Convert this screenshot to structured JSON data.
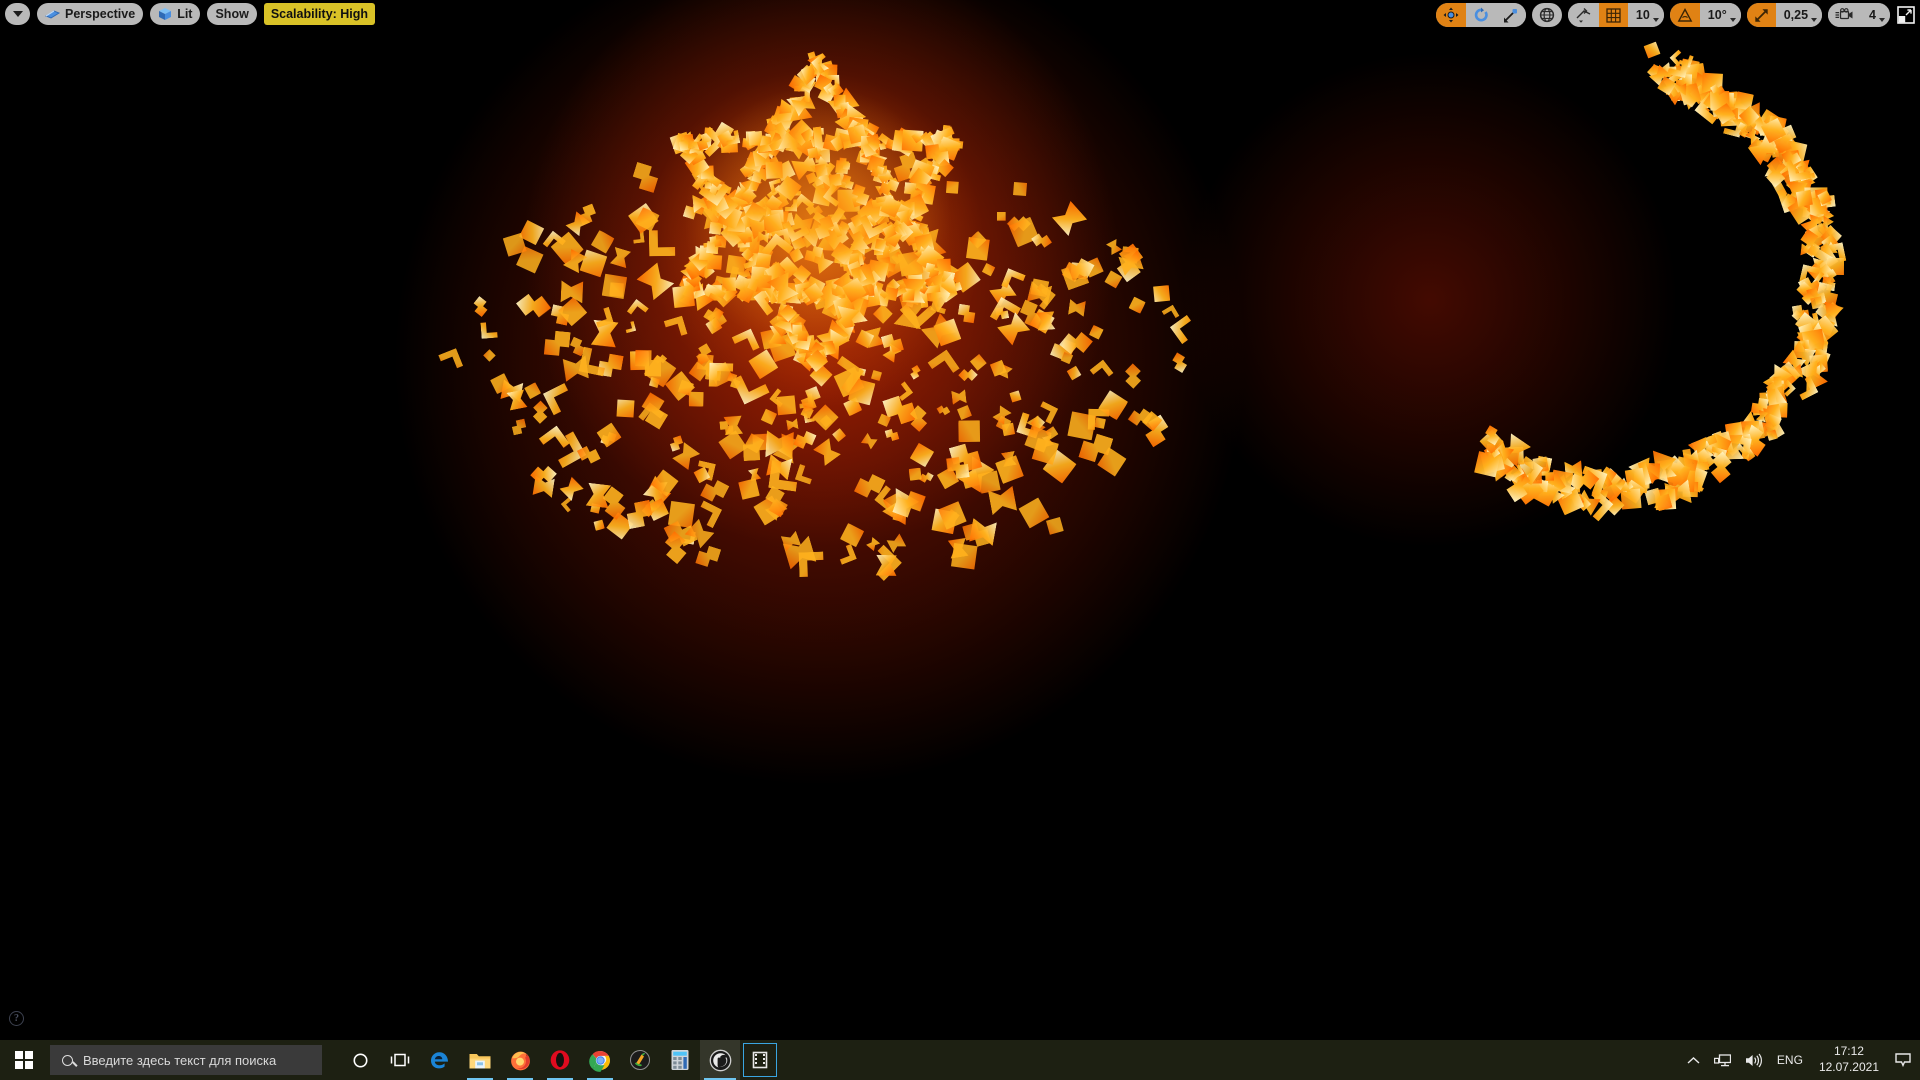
{
  "app": {
    "name": "Unreal Engine 4 Editor",
    "viewport_background": "#000000"
  },
  "viewport_toolbar_left": {
    "menu_caret": {
      "icon": "chevron-down-icon",
      "label": ""
    },
    "camera_mode": {
      "label": "Perspective",
      "icon": "perspective-camera-icon"
    },
    "view_mode": {
      "label": "Lit",
      "icon": "lit-cube-icon"
    },
    "show_menu": {
      "label": "Show"
    },
    "scalability": {
      "label": "Scalability: High",
      "color": "#d9c227"
    }
  },
  "viewport_toolbar_right": {
    "transform_tools": {
      "translate": {
        "icon": "translate-gizmo-icon",
        "active": true
      },
      "rotate": {
        "icon": "rotate-gizmo-icon",
        "active": false
      },
      "scale": {
        "icon": "scale-gizmo-icon",
        "active": false
      }
    },
    "coordinate_system": {
      "icon": "world-globe-icon",
      "active": false
    },
    "surface_snap": {
      "icon": "surface-snap-icon",
      "active": false
    },
    "grid_snap": {
      "icon": "grid-snap-icon",
      "active": true,
      "value": "10"
    },
    "rotation_snap": {
      "icon": "angle-snap-icon",
      "active": true,
      "value": "10°"
    },
    "scale_snap": {
      "icon": "scale-snap-icon",
      "active": true,
      "value": "0,25"
    },
    "camera_speed": {
      "icon": "camera-speed-icon",
      "active": false,
      "value": "4"
    },
    "maximize": {
      "icon": "maximize-viewport-icon"
    }
  },
  "viewport_overlay": {
    "help": {
      "icon": "help-question-icon",
      "label": "?"
    }
  },
  "scene": {
    "description": "Glowing orange particle mesh forming a six-pointed star with scattered debris and a crescent arc on the right",
    "accent_core": "#fff6c8",
    "accent_mid": "#ffb21e",
    "accent_edge": "#ff6a00",
    "accent_bloom": "#8c1400"
  },
  "taskbar": {
    "start": {
      "icon": "windows-logo-icon",
      "label": ""
    },
    "search": {
      "placeholder": "Введите здесь текст для поиска",
      "value": "",
      "icon": "search-icon"
    },
    "items": [
      {
        "name": "cortana",
        "icon": "cortana-circle-icon",
        "label": "Cortana",
        "running": false,
        "active": false
      },
      {
        "name": "task-view",
        "icon": "task-view-icon",
        "label": "Task View",
        "running": false,
        "active": false
      },
      {
        "name": "edge",
        "icon": "edge-icon",
        "label": "Microsoft Edge",
        "running": false,
        "active": false
      },
      {
        "name": "file-explorer",
        "icon": "folder-icon",
        "label": "File Explorer",
        "running": true,
        "active": false
      },
      {
        "name": "firefox",
        "icon": "firefox-icon",
        "label": "Firefox",
        "running": true,
        "active": false
      },
      {
        "name": "opera",
        "icon": "opera-icon",
        "label": "Opera",
        "running": true,
        "active": false
      },
      {
        "name": "chrome",
        "icon": "chrome-icon",
        "label": "Google Chrome",
        "running": true,
        "active": false
      },
      {
        "name": "fl-studio",
        "icon": "fl-studio-icon",
        "label": "FL Studio",
        "running": false,
        "active": false
      },
      {
        "name": "calculator",
        "icon": "calculator-icon",
        "label": "Calculator",
        "running": false,
        "active": false
      },
      {
        "name": "unreal-engine",
        "icon": "unreal-engine-icon",
        "label": "Unreal Engine",
        "running": true,
        "active": true
      },
      {
        "name": "media-player",
        "icon": "media-film-icon",
        "label": "Media",
        "running": false,
        "active": false,
        "framed": true
      }
    ],
    "tray": {
      "overflow": {
        "icon": "chevron-up-icon",
        "label": ""
      },
      "network": {
        "icon": "network-icon",
        "label": ""
      },
      "volume": {
        "icon": "speaker-icon",
        "label": ""
      },
      "language": {
        "label": "ENG"
      },
      "clock": {
        "time": "17:12",
        "date": "12.07.2021"
      },
      "notifications": {
        "icon": "notification-bubble-icon",
        "label": ""
      }
    }
  }
}
